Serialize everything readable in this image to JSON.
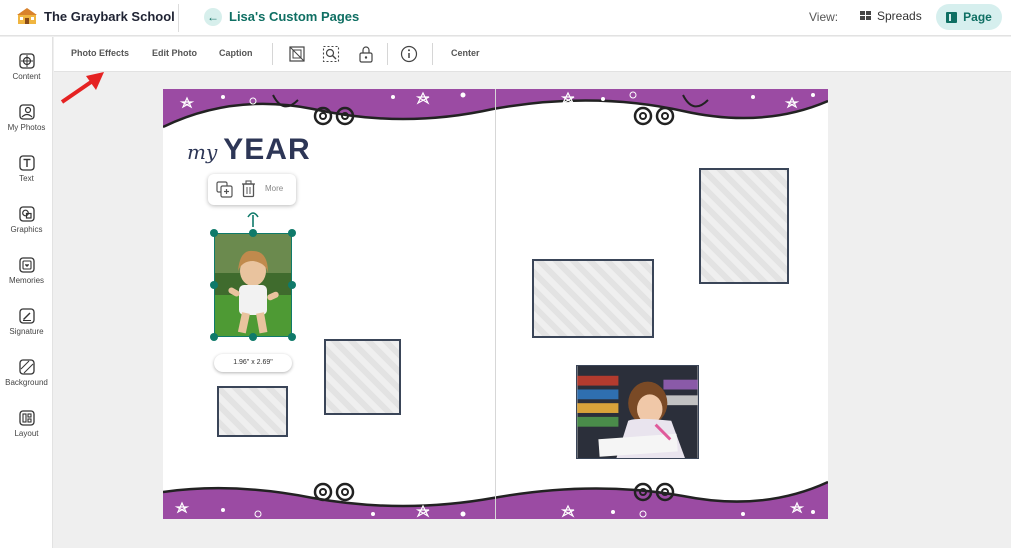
{
  "header": {
    "school_name": "The Graybark School",
    "project_title": "Lisa's Custom Pages",
    "view_label": "View:",
    "spreads_label": "Spreads",
    "page_label": "Page"
  },
  "sidebar": {
    "items": [
      {
        "label": "Content",
        "icon": "content-icon"
      },
      {
        "label": "My Photos",
        "icon": "photos-icon"
      },
      {
        "label": "Text",
        "icon": "text-icon"
      },
      {
        "label": "Graphics",
        "icon": "graphics-icon"
      },
      {
        "label": "Memories",
        "icon": "memories-icon"
      },
      {
        "label": "Signature",
        "icon": "signature-icon"
      },
      {
        "label": "Background",
        "icon": "background-icon"
      },
      {
        "label": "Layout",
        "icon": "layout-icon"
      }
    ]
  },
  "toolbar": {
    "photo_effects": "Photo Effects",
    "edit_photo": "Edit Photo",
    "caption": "Caption",
    "center": "Center"
  },
  "page": {
    "title_script": "my",
    "title_bold": "YEAR",
    "context_more": "More",
    "size_label": "1.96\" x 2.69\""
  },
  "colors": {
    "accent": "#0f6f63",
    "border_purple": "#9b4ba3",
    "frame": "#3a4558",
    "arrow": "#e52222"
  }
}
